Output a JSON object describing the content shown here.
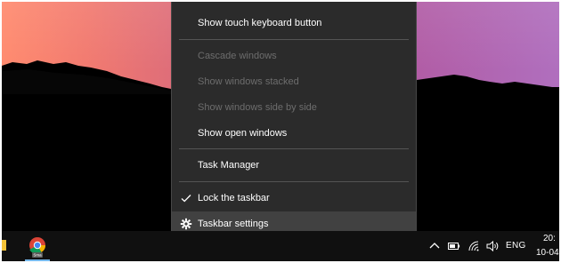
{
  "context_menu": {
    "items": [
      {
        "label": "Show touch keyboard button",
        "enabled": true
      },
      {
        "label": "Cascade windows",
        "enabled": false
      },
      {
        "label": "Show windows stacked",
        "enabled": false
      },
      {
        "label": "Show windows side by side",
        "enabled": false
      },
      {
        "label": "Show open windows",
        "enabled": true
      },
      {
        "label": "Task Manager",
        "enabled": true
      },
      {
        "label": "Lock the taskbar",
        "enabled": true,
        "checked": true,
        "icon": "checkmark-icon"
      },
      {
        "label": "Taskbar settings",
        "enabled": true,
        "highlighted": true,
        "icon": "gear-icon"
      }
    ]
  },
  "taskbar": {
    "pinned_app": {
      "icon": "chrome-icon",
      "badge": "Sma"
    },
    "tray": {
      "icons": [
        "chevron-up-icon",
        "battery-icon",
        "wifi-icon",
        "volume-icon"
      ],
      "language": "ENG",
      "time": "20:",
      "date": "10-04"
    }
  },
  "colors": {
    "menu_background": "#2b2b2b",
    "menu_highlight": "#414141",
    "menu_disabled_text": "#6d6d6d",
    "taskbar_background": "#101010",
    "accent": "#76b9ed"
  }
}
